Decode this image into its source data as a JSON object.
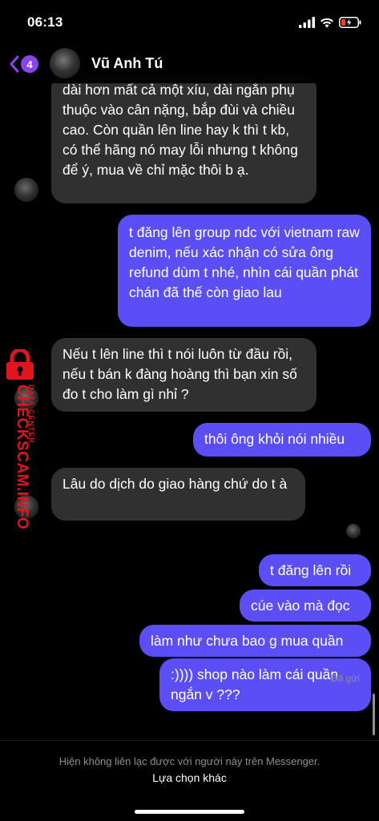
{
  "status": {
    "time": "06:13"
  },
  "header": {
    "back_count": "4",
    "contact_name": "Vũ Anh Tú"
  },
  "messages": [
    {
      "dir": "in",
      "text": "dài hơn mất cả một xíu, dài ngắn phụ thuộc vào cân nặng, bắp đùi và chiều cao. Còn quần lên line hay k thì t kb, có thể hãng nó may lỗi nhưng t không để ý, mua về chỉ mặc thôi b ạ."
    },
    {
      "dir": "out",
      "text": "t đăng lên group ndc với vietnam raw denim, nếu xác nhận có sửa ông refund dùm t nhé, nhìn cái quần phát chán đã thế còn giao lau"
    },
    {
      "dir": "in",
      "text": "Nếu t lên line thì t nói luôn từ đầu rồi, nếu t bán k đàng hoàng thì bạn xin số đo t cho làm gì nhỉ ?"
    },
    {
      "dir": "out",
      "text": "thôi ông khỏi nói nhiều"
    },
    {
      "dir": "in",
      "text": "Lâu do dịch do giao hàng chứ do t à"
    },
    {
      "dir": "out",
      "text": "t đăng lên rồi"
    },
    {
      "dir": "out",
      "text": "cúe vào mà đọc"
    },
    {
      "dir": "out",
      "text": "làm như chưa bao g mua quần"
    },
    {
      "dir": "out",
      "text": ":)))) shop nào làm cái quần ngắn v ???"
    }
  ],
  "sent_status": "Đã gửi",
  "watermark": {
    "text": "CHECKSCAM.INFO",
    "subtext": "DATA CENTER"
  },
  "footer": {
    "notice": "Hiện không liên lạc được với người này trên Messenger.",
    "action": "Lựa chọn khác"
  },
  "colors": {
    "incoming": "#303030",
    "outgoing": "#5b4ef6",
    "accent": "#8a44f0",
    "watermark": "#e0151d"
  }
}
